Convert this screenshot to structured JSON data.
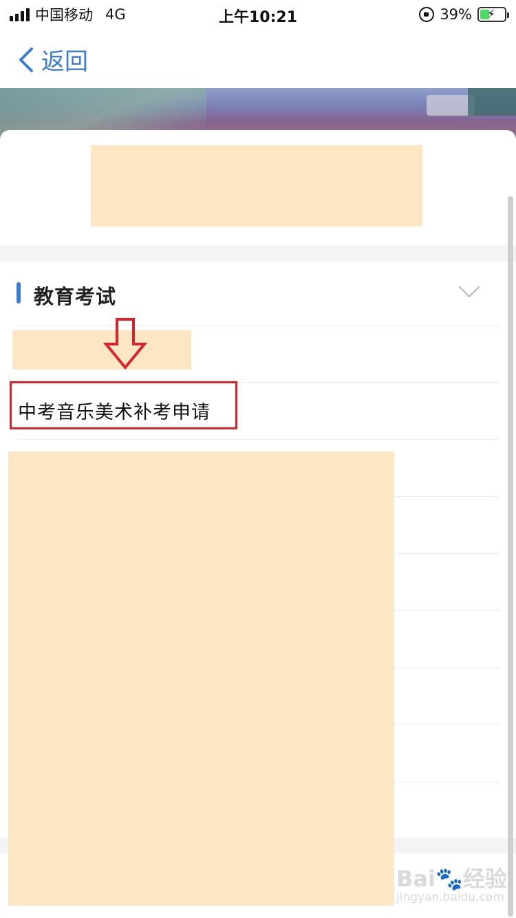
{
  "status_bar": {
    "carrier": "中国移动",
    "network": "4G",
    "time": "上午10:21",
    "battery": "39%",
    "battery_level": 0.39
  },
  "nav": {
    "back_label": "返回"
  },
  "section": {
    "title": "教育考试",
    "items": [
      {
        "label": ""
      },
      {
        "label": "中考音乐美术补考申请"
      },
      {
        "label": ""
      },
      {
        "label": ""
      },
      {
        "label": ""
      },
      {
        "label": ""
      },
      {
        "label": ""
      },
      {
        "label": ""
      }
    ]
  },
  "watermark": {
    "logo": "Bai🐾经验",
    "url": "jingyan.baidu.com"
  },
  "colors": {
    "accent": "#3a7bd5",
    "highlight": "#d9232c",
    "redaction": "#fde6c4"
  }
}
